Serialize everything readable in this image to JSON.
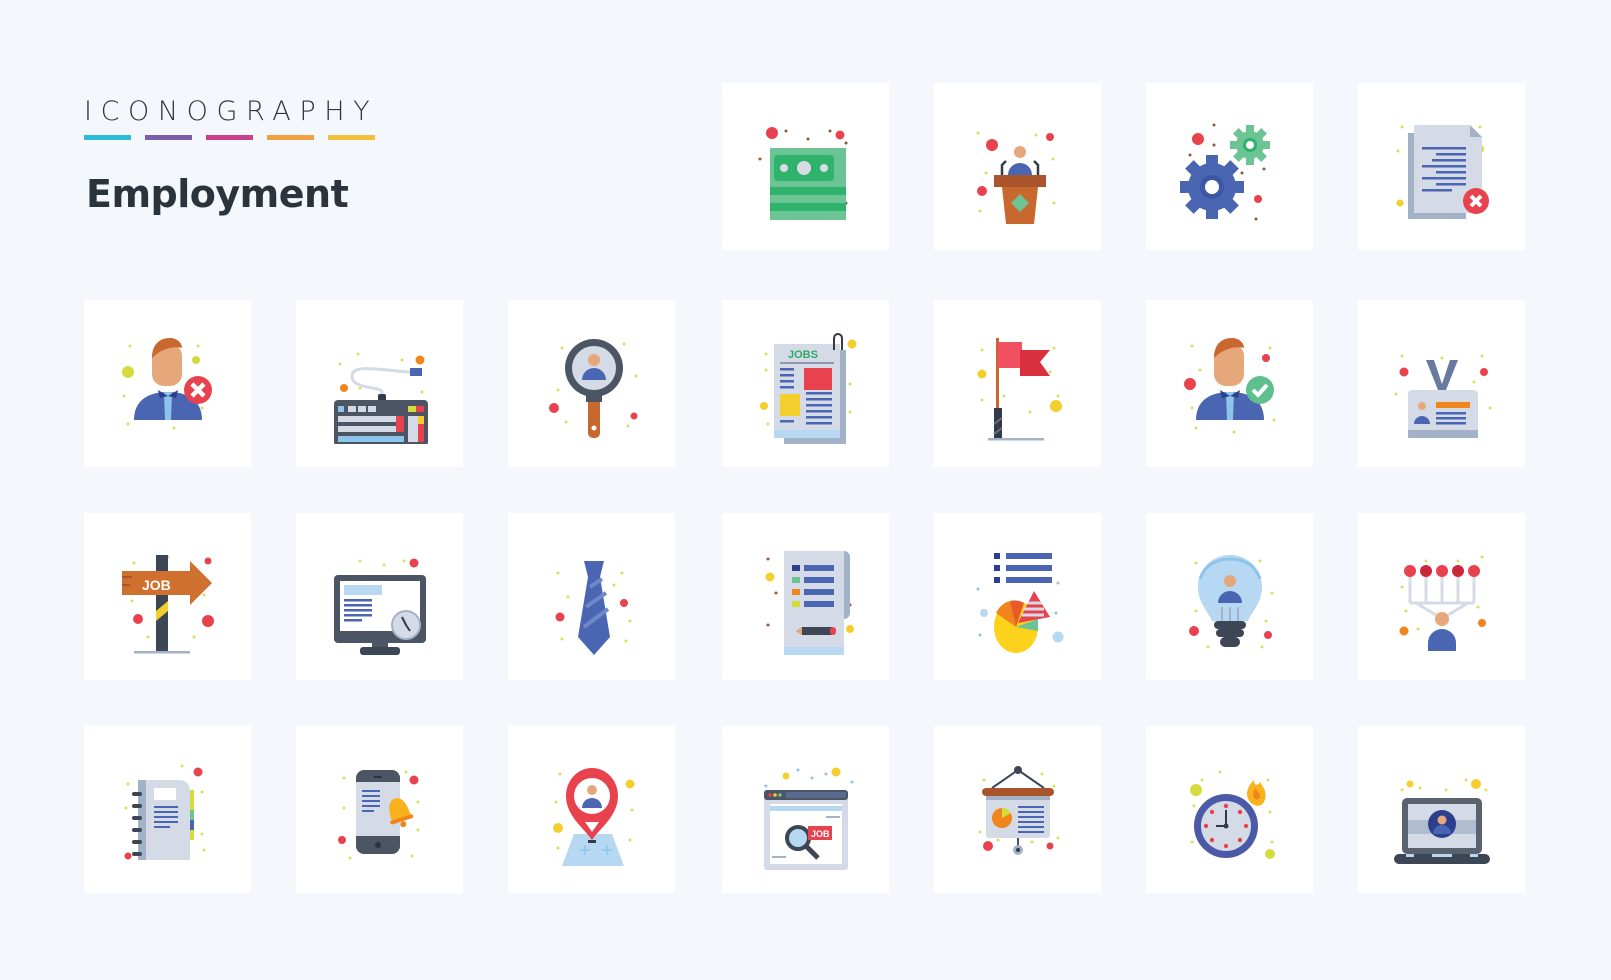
{
  "header": {
    "kicker": "ICONOGRAPHY",
    "title": "Employment",
    "stripe_colors": [
      "#2bbcd8",
      "#7b5ea8",
      "#c8408f",
      "#f0a040",
      "#f2bf3a"
    ]
  },
  "icons": [
    {
      "name": "money-stack-icon"
    },
    {
      "name": "podium-speaker-icon"
    },
    {
      "name": "gears-settings-icon"
    },
    {
      "name": "rejected-document-icon"
    },
    {
      "name": "rejected-candidate-icon"
    },
    {
      "name": "keyboard-icon"
    },
    {
      "name": "search-candidate-icon"
    },
    {
      "name": "jobs-newspaper-icon",
      "label": "JOBS"
    },
    {
      "name": "red-flag-icon"
    },
    {
      "name": "approved-candidate-icon"
    },
    {
      "name": "id-badge-icon"
    },
    {
      "name": "job-signpost-icon",
      "label": "JOB"
    },
    {
      "name": "monitor-clock-icon"
    },
    {
      "name": "necktie-icon"
    },
    {
      "name": "checklist-document-icon"
    },
    {
      "name": "pie-chart-report-icon"
    },
    {
      "name": "idea-bulb-person-icon"
    },
    {
      "name": "candidate-choice-icon"
    },
    {
      "name": "notebook-icon"
    },
    {
      "name": "mobile-notification-icon"
    },
    {
      "name": "location-pin-person-icon"
    },
    {
      "name": "job-search-browser-icon",
      "label": "JOB"
    },
    {
      "name": "presentation-board-icon"
    },
    {
      "name": "deadline-clock-fire-icon"
    },
    {
      "name": "laptop-profile-icon"
    }
  ]
}
